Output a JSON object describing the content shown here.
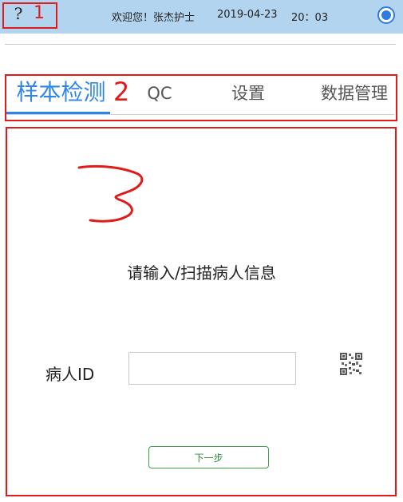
{
  "status_bar": {
    "greeting": "欢迎您！张杰护士",
    "date": "2019-04-23",
    "time": "20：03",
    "help_glyph": "?",
    "help_icon": "question-mark-icon",
    "record_icon": "record-icon"
  },
  "annotations": {
    "label_1": "1",
    "label_2": "2",
    "label_3": "3",
    "color": "#e01b1b"
  },
  "tabs": [
    {
      "label": "样本检测",
      "active": true
    },
    {
      "label": "QC",
      "active": false
    },
    {
      "label": "设置",
      "active": false
    },
    {
      "label": "数据管理",
      "active": false
    }
  ],
  "main": {
    "prompt": "请输入/扫描病人信息",
    "patient_id_label": "病人ID",
    "patient_id_value": "",
    "qr_icon": "qr-code-icon",
    "next_button_label": "下一步"
  },
  "colors": {
    "status_bar_bg": "#b3d4ef",
    "accent": "#2f86e8",
    "button_green": "#3aa04a"
  }
}
